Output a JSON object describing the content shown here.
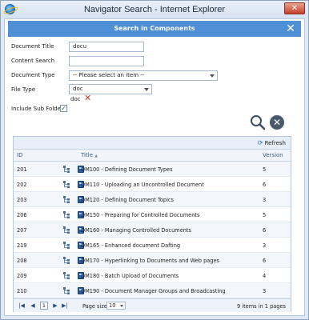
{
  "window": {
    "title": "Navigator Search - Internet Explorer",
    "close_glyph": "✕"
  },
  "panel": {
    "title": "Search in Components",
    "close_glyph": "✕"
  },
  "form": {
    "document_title_label": "Document Title",
    "document_title_value": "docu",
    "content_search_label": "Content Search",
    "content_search_value": "",
    "document_type_label": "Document Type",
    "document_type_value": "-- Please select an item --",
    "file_type_label": "File Type",
    "file_type_value": "doc",
    "file_type_selected": "doc",
    "include_subfolders_label": "Include Sub Folders",
    "include_subfolders_checked": true
  },
  "actions": {
    "search_icon": "search-icon",
    "clear_icon": "clear-icon"
  },
  "grid": {
    "refresh_label": "Refresh",
    "columns": {
      "id": "ID",
      "title": "Title",
      "version": "Version"
    },
    "rows": [
      {
        "id": "201",
        "title": "DM100 - Defining Document Types",
        "version": "5"
      },
      {
        "id": "202",
        "title": "DM110 - Uploading an Uncontrolled Document",
        "version": "6"
      },
      {
        "id": "203",
        "title": "DM120 - Defining Document Topics",
        "version": "3"
      },
      {
        "id": "206",
        "title": "DM150 - Preparing for Controlled Documents",
        "version": "5"
      },
      {
        "id": "207",
        "title": "DM160 - Managing Controlled Documents",
        "version": "6"
      },
      {
        "id": "219",
        "title": "DM165 - Enhanced document Dafting",
        "version": "3"
      },
      {
        "id": "208",
        "title": "DM170 - Hyperlinking to Documents and Web pages",
        "version": "6"
      },
      {
        "id": "209",
        "title": "DM180 - Batch Upload of Documents",
        "version": "4"
      },
      {
        "id": "210",
        "title": "DM190 - Document Manager Groups and Broadcasting",
        "version": "3"
      }
    ],
    "pager": {
      "current_page": "1",
      "page_size_label": "Page size:",
      "page_size_value": "10",
      "info": "9 items in 1 pages"
    }
  }
}
